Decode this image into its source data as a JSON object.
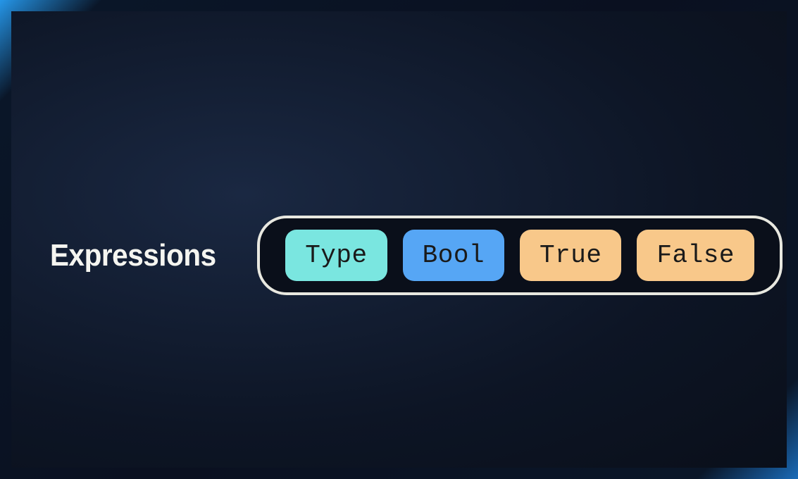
{
  "heading": "Expressions",
  "pills": [
    {
      "label": "Type",
      "color": "cyan"
    },
    {
      "label": "Bool",
      "color": "blue"
    },
    {
      "label": "True",
      "color": "orange"
    },
    {
      "label": "False",
      "color": "orange"
    }
  ],
  "colors": {
    "cyan": "#7ae6e0",
    "blue": "#56a6f5",
    "orange": "#f8c88a"
  }
}
